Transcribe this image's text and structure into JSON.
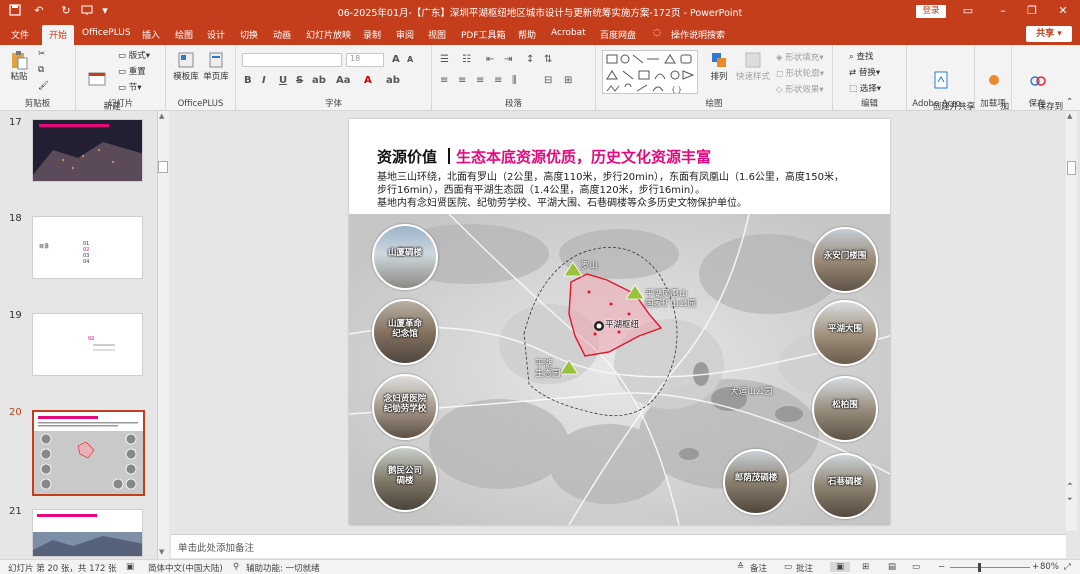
{
  "titlebar": {
    "title": "06-2025年01月-【广东】深圳平湖枢纽地区城市设计与更新统筹实施方案-172页  -  PowerPoint",
    "login": "登录",
    "quick_access": {
      "save_icon": "save-icon",
      "undo_icon": "undo-icon",
      "redo_icon": "redo-icon"
    }
  },
  "tabs": [
    "文件",
    "开始",
    "OfficePLUS",
    "插入",
    "绘图",
    "设计",
    "切换",
    "动画",
    "幻灯片放映",
    "录制",
    "审阅",
    "视图",
    "PDF工具箱",
    "帮助",
    "Acrobat",
    "百度网盘",
    "操作说明搜索"
  ],
  "active_tab": "开始",
  "share": "共享",
  "ribbon": {
    "clipboard": {
      "paste": "粘贴",
      "label": "剪贴板"
    },
    "slides": {
      "new_slide": "新建\n幻灯片",
      "layout": "版式",
      "reset": "重置",
      "section": "节",
      "label": "幻灯片"
    },
    "officeplus": {
      "template": "模板库",
      "single": "单页库",
      "label": "OfficePLUS"
    },
    "font": {
      "font_size": "18",
      "label": "字体"
    },
    "paragraph": {
      "label": "段落"
    },
    "drawing": {
      "arrange": "排列",
      "quick_styles": "快速样式",
      "fill": "形状填充",
      "outline": "形状轮廓",
      "effects": "形状效果",
      "label": "绘图"
    },
    "editing": {
      "find": "查找",
      "replace": "替换",
      "select": "选择",
      "label": "编辑"
    },
    "adobe": {
      "create": "创建并共享\nAdobe PDF",
      "label": "Adobe Acro..."
    },
    "addins": {
      "addin": "加\n载项",
      "label": "加载项"
    },
    "save": {
      "save_baidu": "保存到\n百度网盘",
      "label": "保存"
    }
  },
  "thumbnails": [
    {
      "num": "17",
      "selected": false
    },
    {
      "num": "18",
      "selected": false,
      "items": [
        "01",
        "02",
        "03",
        "04"
      ]
    },
    {
      "num": "19",
      "selected": false,
      "items": [
        "02"
      ]
    },
    {
      "num": "20",
      "selected": true
    },
    {
      "num": "21",
      "selected": false
    }
  ],
  "slide": {
    "title_a": "资源价值",
    "title_b": "生态本底资源优质，历史文化资源丰富",
    "body": [
      "基地三山环绕，北面有罗山（2公里，高度110米，步行20min），东面有凤凰山（1.6公里，高度150米，",
      "步行16min），西面有平湖生态园（1.4公里，高度120米，步行16min）。",
      "基地内有念妇贤医院、纪劬劳学校、平湖大围、石巷碉楼等众多历史文物保护单位。"
    ],
    "map_labels": {
      "luoshan": "罗山",
      "fenghuang": "平湖凤凰山\n国家矿山公园",
      "hub": "平湖枢纽",
      "eco": "平湖\n生态园",
      "dayun": "大运山公园"
    },
    "circles_left": [
      "山厦碉楼",
      "山厦革命\n纪念馆",
      "念妇贤医院\n纪劬劳学校",
      "鹅民公司\n碉楼"
    ],
    "circles_right": [
      "永安门楼围",
      "平湖大围",
      "松柏围",
      "石巷碉楼"
    ],
    "circle_bottom": "郎荫茂碉楼"
  },
  "notes": "单击此处添加备注",
  "status": {
    "slide_info": "幻灯片 第 20 张，共 172 张",
    "language": "简体中文(中国大陆)",
    "accessibility": "辅助功能: 一切就绪",
    "notes_btn": "备注",
    "comments_btn": "批注",
    "zoom": "80%"
  },
  "colors": {
    "brand": "#c43e1c",
    "accent_pink": "#e6097d"
  }
}
